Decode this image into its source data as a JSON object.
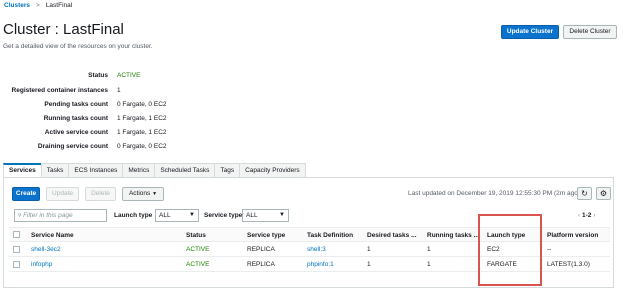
{
  "breadcrumb": {
    "parent": "Clusters",
    "separator": ">",
    "current": "LastFinal"
  },
  "header": {
    "title": "Cluster : LastFinal",
    "subtitle": "Get a detailed view of the resources on your cluster.",
    "update_button": "Update Cluster",
    "delete_button": "Delete Cluster"
  },
  "details": [
    {
      "label": "Status",
      "value": "ACTIVE"
    },
    {
      "label": "Registered container instances",
      "value": "1"
    },
    {
      "label": "Pending tasks count",
      "value": "0 Fargate, 0 EC2"
    },
    {
      "label": "Running tasks count",
      "value": "1 Fargate, 1 EC2"
    },
    {
      "label": "Active service count",
      "value": "1 Fargate, 1 EC2"
    },
    {
      "label": "Draining service count",
      "value": "0 Fargate, 0 EC2"
    }
  ],
  "tabs": [
    "Services",
    "Tasks",
    "ECS Instances",
    "Metrics",
    "Scheduled Tasks",
    "Tags",
    "Capacity Providers"
  ],
  "toolbar": {
    "create": "Create",
    "update": "Update",
    "delete": "Delete",
    "actions": "Actions",
    "last_updated": "Last updated on December 19, 2019 12:55:30 PM (2m ago)"
  },
  "filters": {
    "search_placeholder": "Filter in this page",
    "launch_type_label": "Launch type",
    "launch_type_value": "ALL",
    "service_type_label": "Service type",
    "service_type_value": "ALL",
    "pagination": "1-2"
  },
  "table": {
    "columns": [
      "Service Name",
      "Status",
      "Service type",
      "Task Definition",
      "Desired tasks ...",
      "Running tasks ...",
      "Launch type",
      "Platform version"
    ],
    "rows": [
      {
        "service_name": "shell-3ec2",
        "status": "ACTIVE",
        "service_type": "REPLICA",
        "task_definition": "shell:3",
        "desired": "1",
        "running": "1",
        "launch_type": "EC2",
        "platform_version": "--"
      },
      {
        "service_name": "infophp",
        "status": "ACTIVE",
        "service_type": "REPLICA",
        "task_definition": "phpinfo:1",
        "desired": "1",
        "running": "1",
        "launch_type": "FARGATE",
        "platform_version": "LATEST(1.3.0)"
      }
    ]
  },
  "colors": {
    "accent": "#0073bb",
    "primary_button": "#0b73ce",
    "active_status": "#1d8102",
    "highlight": "#d9534f"
  }
}
